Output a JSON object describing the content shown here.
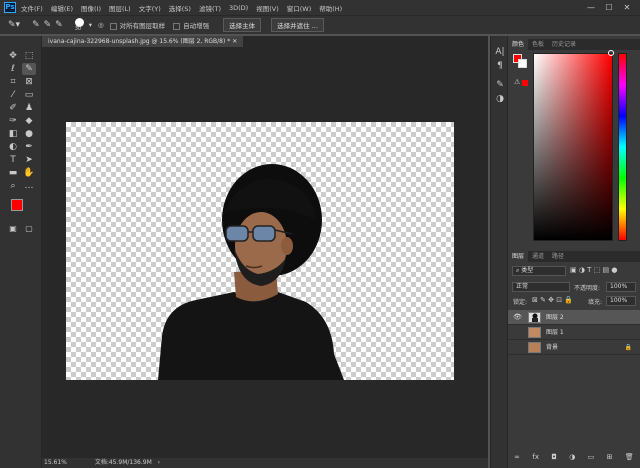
{
  "app": {
    "logo": "Ps"
  },
  "menus": [
    "文件(F)",
    "编辑(E)",
    "图像(I)",
    "图层(L)",
    "文字(Y)",
    "选择(S)",
    "滤镜(T)",
    "3D(D)",
    "视图(V)",
    "窗口(W)",
    "帮助(H)"
  ],
  "window_controls": {
    "minimize": "—",
    "maximize": "☐",
    "close": "✕"
  },
  "options": {
    "brush_size": "30",
    "sample_all_layers": "对所有图层取样",
    "auto_enhance": "自动增强",
    "select_subject": "选择主体",
    "select_and_mask": "选择并遮住 ..."
  },
  "document": {
    "tab_title": "ivana-cajina-322968-unsplash.jpg @ 15.6% (图层 2, RGB/8) *",
    "zoom": "15.61%",
    "doc_info": "文档:45.9M/136.9M"
  },
  "colors": {
    "foreground": "#ff0000",
    "background": "#ffffff"
  },
  "panels": {
    "color_tabs": [
      "颜色",
      "色板",
      "历史记录"
    ],
    "layer_tabs": [
      "图层",
      "通道",
      "路径"
    ],
    "layer_kind": "类型",
    "blend_mode": "正常",
    "opacity_label": "不透明度:",
    "opacity_value": "100%",
    "lock_label": "锁定:",
    "fill_label": "填充:",
    "fill_value": "100%",
    "layers": [
      {
        "name": "图层 2",
        "visible": true,
        "selected": true
      },
      {
        "name": "图层 1",
        "visible": false,
        "selected": false
      },
      {
        "name": "背景",
        "visible": false,
        "selected": false,
        "locked": true
      }
    ]
  },
  "icons": [
    "move-icon",
    "marquee-icon",
    "lasso-icon",
    "quick-select-icon",
    "crop-icon",
    "eyedropper-icon",
    "brush-icon",
    "stamp-icon",
    "eraser-icon",
    "gradient-icon",
    "pen-icon",
    "text-icon",
    "hand-icon",
    "zoom-icon"
  ]
}
